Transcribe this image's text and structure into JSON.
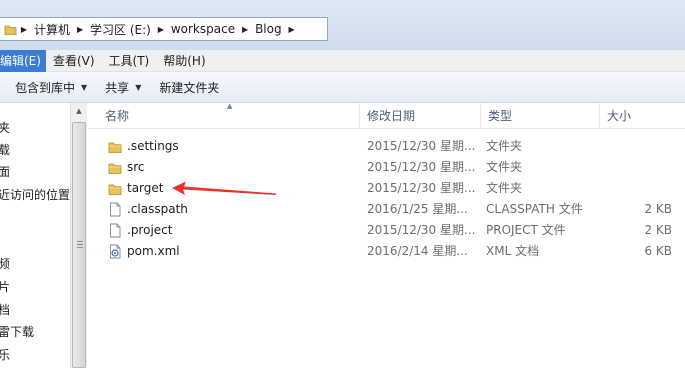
{
  "address": {
    "crumbs": [
      "计算机",
      "学习区 (E:)",
      "workspace",
      "Blog"
    ]
  },
  "menu": {
    "items": [
      "编辑(E)",
      "查看(V)",
      "工具(T)",
      "帮助(H)"
    ]
  },
  "toolbar": {
    "include_library": "包含到库中",
    "share": "共享",
    "new_folder": "新建文件夹"
  },
  "nav": {
    "items": [
      "夹",
      "载",
      "面",
      "近访问的位置",
      "频",
      "片",
      "档",
      "雷下载",
      "乐"
    ]
  },
  "columns": {
    "name": "名称",
    "date": "修改日期",
    "type": "类型",
    "size": "大小"
  },
  "files": [
    {
      "name": ".settings",
      "date": "2015/12/30 星期...",
      "type": "文件夹",
      "size": "",
      "icon": "folder-icon"
    },
    {
      "name": "src",
      "date": "2015/12/30 星期...",
      "type": "文件夹",
      "size": "",
      "icon": "folder-icon"
    },
    {
      "name": "target",
      "date": "2015/12/30 星期...",
      "type": "文件夹",
      "size": "",
      "icon": "folder-icon"
    },
    {
      "name": ".classpath",
      "date": "2016/1/25 星期...",
      "type": "CLASSPATH 文件",
      "size": "2 KB",
      "icon": "file-icon"
    },
    {
      "name": ".project",
      "date": "2015/12/30 星期...",
      "type": "PROJECT 文件",
      "size": "2 KB",
      "icon": "file-icon"
    },
    {
      "name": "pom.xml",
      "date": "2016/2/14 星期...",
      "type": "XML 文档",
      "size": "6 KB",
      "icon": "xml-file-icon"
    }
  ],
  "colors": {
    "accent": "#3a7bd5",
    "annotation": "#e8332a",
    "folder": "#e8c25a"
  }
}
